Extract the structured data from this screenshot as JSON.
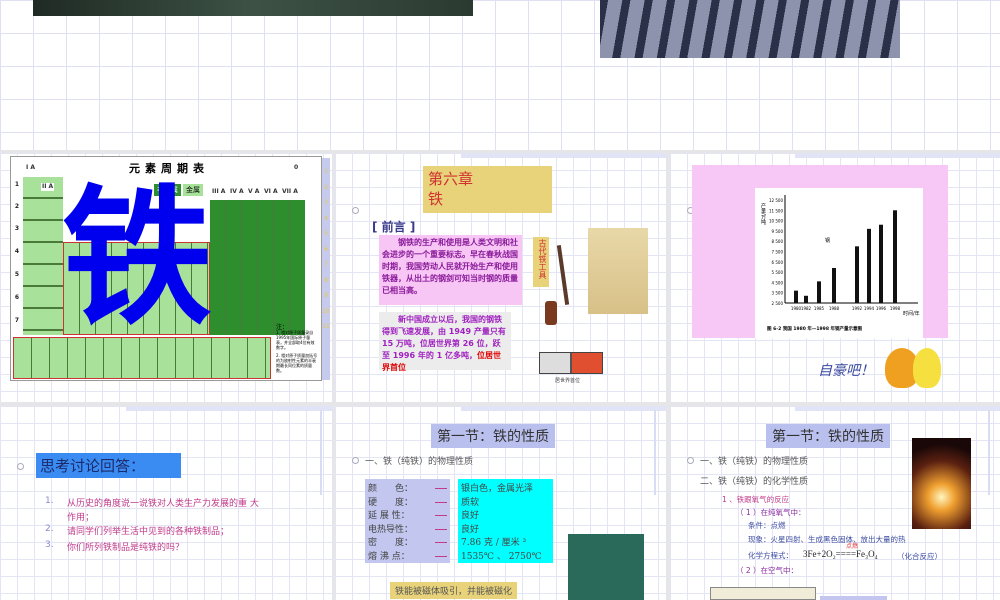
{
  "slide1": {
    "table_title": "元素周期表",
    "big_char": "铁",
    "legend_nonmetal": "非金属",
    "legend_metal": "金属",
    "notes_title": "注：",
    "note1": "1. 相对原子质量录自1995年国际原子量表，并全部取4位有效数字。",
    "note2": "2. 相对原子质量加括号的为放射性元素的半衰期最长同位素的质量数。",
    "period_numbers": [
      "1",
      "2",
      "3",
      "4",
      "5",
      "6",
      "7"
    ],
    "group_labels": [
      "I A",
      "II A",
      "III A",
      "IV A",
      "V A",
      "VI A",
      "VII A",
      "0"
    ],
    "side_numbers": [
      "1",
      "2",
      "3",
      "4",
      "5",
      "6",
      "7",
      "8",
      "9",
      "10",
      "11"
    ]
  },
  "slide2": {
    "chapter_title_line1": "第六章",
    "chapter_title_line2": "铁",
    "preface": "[ 前言 ]",
    "paragraph1": "钢铁的生产和使用是人类文明和社会进步的一个重要标志。早在春秋战国时期，我国劳动人民就开始生产和使用铁器，从出土的钢剑可知当时钢的质量已相当高。",
    "paragraph2_a": "新中国成立以后，我国的钢铁得到飞速发展，由 1949 产量只有 15 万吨，位居世界第 26 位，跃至 1996 年的 1 亿多吨，",
    "paragraph2_highlight": "位居世界首位",
    "tools_label": "古代铁工具",
    "stamp_caption": "居世界首位"
  },
  "slide3": {
    "proud_text": "自豪吧！"
  },
  "chart_data": {
    "type": "bar",
    "title": "图 6-2 我国 1980 年—1998 年钢产量示意图",
    "xlabel": "时间/年",
    "ylabel": "产量/万吨",
    "series_label": "钢",
    "categories": [
      "1980",
      "1982",
      "1985",
      "1988",
      "1992",
      "1994",
      "1996",
      "1998"
    ],
    "values": [
      3700,
      3200,
      4600,
      5900,
      8000,
      9700,
      10100,
      11500
    ],
    "ylim": [
      2500,
      12500
    ],
    "yticks": [
      "2 500",
      "3 500",
      "4 500",
      "5 500",
      "6 500",
      "7 500",
      "8 500",
      "9 500",
      "10 500",
      "11 500",
      "12 500"
    ]
  },
  "slide4": {
    "title": "思考讨论回答：",
    "items": [
      {
        "num": "1.",
        "text": "从历史的角度说一说铁对人类生产力发展的重 大",
        "text2": "作用；"
      },
      {
        "num": "2.",
        "text": "请同学们列举生活中见到的各种铁制品；"
      },
      {
        "num": "3.",
        "text": "你们所列铁制品是纯铁的吗？"
      }
    ]
  },
  "slide5": {
    "title": "第一节：铁的性质",
    "heading": "一、铁（纯铁）的物理性质",
    "props": [
      {
        "k": "颜　　色：",
        "v": "银白色，金属光泽"
      },
      {
        "k": "硬　　度：",
        "v": "质软"
      },
      {
        "k": "延 展 性：",
        "v": "良好"
      },
      {
        "k": "电热导性：",
        "v": "良好"
      },
      {
        "k": "密　　度：",
        "v": "7.86 克 / 厘米 ³"
      },
      {
        "k": "熔 沸 点：",
        "v": "1535℃ 、 2750℃"
      }
    ],
    "magnet": "铁能被磁体吸引，并能被磁化"
  },
  "slide6": {
    "title": "第一节：铁的性质",
    "h1": "一、铁（纯铁）的物理性质",
    "h2": "二、铁（纯铁）的化学性质",
    "s1": "1 、铁跟氧气的反应",
    "s1a": "（ 1 ）在纯氧气中：",
    "cond": "条件：点燃",
    "phen": "现象：火星四射、生成黑色固体、放出大量的热",
    "eq_label": "化学方程式：",
    "eq": "3Fe+2O₂====Fe₃O₄",
    "eq_cond": "点燃",
    "eq_type": "（化合反应）",
    "s1b": "（ 2 ）在空气中："
  }
}
